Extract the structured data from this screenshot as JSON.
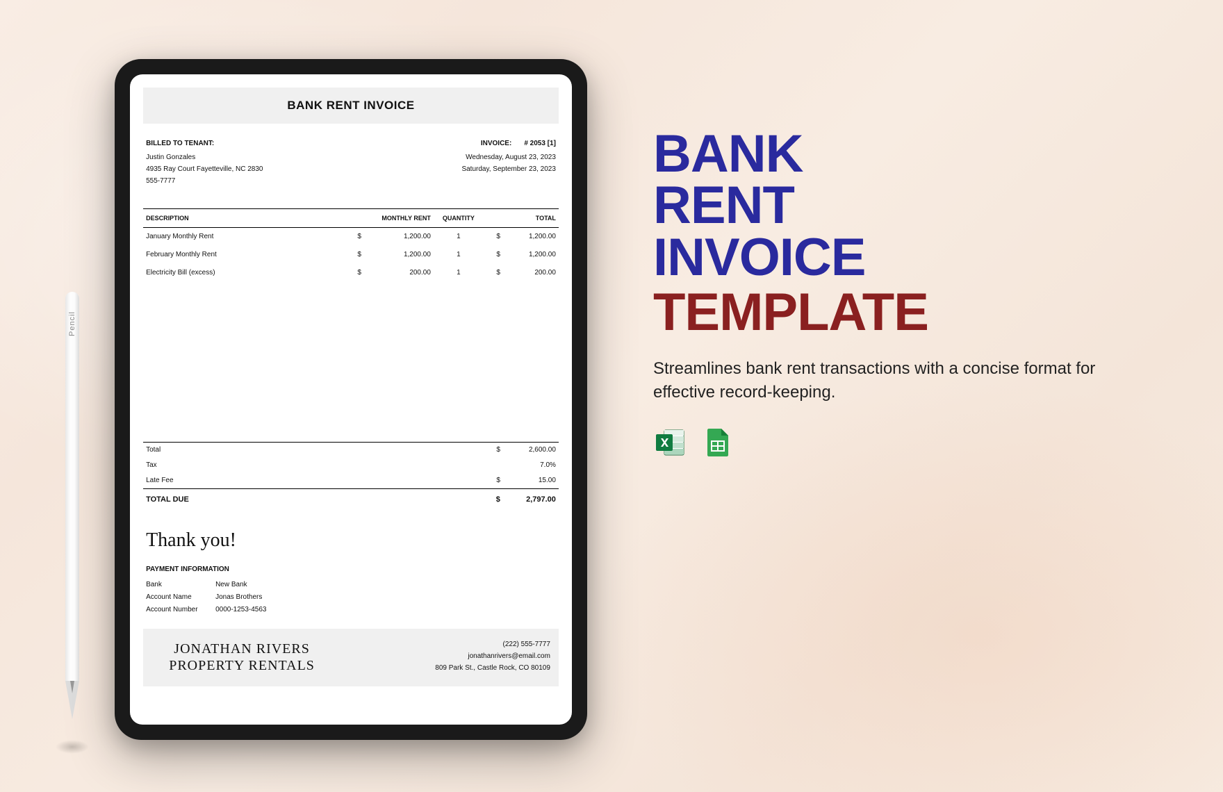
{
  "pencil": {
    "label": "Pencil"
  },
  "invoice": {
    "title": "BANK RENT INVOICE",
    "billed_to_label": "BILLED TO TENANT:",
    "tenant_name": "Justin Gonzales",
    "tenant_address": "4935 Ray Court Fayetteville, NC 2830",
    "tenant_phone": "555-7777",
    "invoice_label": "INVOICE:",
    "invoice_number": "# 2053 [1]",
    "date1": "Wednesday, August 23, 2023",
    "date2": "Saturday, September 23, 2023",
    "columns": {
      "description": "DESCRIPTION",
      "monthly_rent": "MONTHLY RENT",
      "quantity": "QUANTITY",
      "total": "TOTAL"
    },
    "items": [
      {
        "desc": "January Monthly Rent",
        "cur": "$",
        "rent": "1,200.00",
        "qty": "1",
        "tcur": "$",
        "total": "1,200.00"
      },
      {
        "desc": "February Monthly Rent",
        "cur": "$",
        "rent": "1,200.00",
        "qty": "1",
        "tcur": "$",
        "total": "1,200.00"
      },
      {
        "desc": "Electricity Bill (excess)",
        "cur": "$",
        "rent": "200.00",
        "qty": "1",
        "tcur": "$",
        "total": "200.00"
      }
    ],
    "totals": {
      "total_label": "Total",
      "total_cur": "$",
      "total_val": "2,600.00",
      "tax_label": "Tax",
      "tax_val": "7.0%",
      "late_label": "Late Fee",
      "late_cur": "$",
      "late_val": "15.00",
      "due_label": "TOTAL DUE",
      "due_cur": "$",
      "due_val": "2,797.00"
    },
    "thankyou": "Thank you!",
    "payment": {
      "label": "PAYMENT INFORMATION",
      "bank_label": "Bank",
      "bank": "New Bank",
      "account_name_label": "Account Name",
      "account_name": "Jonas Brothers",
      "account_number_label": "Account Number",
      "account_number": "0000-1253-4563"
    },
    "footer": {
      "company": "JONATHAN RIVERS PROPERTY RENTALS",
      "phone": "(222) 555-7777",
      "email": "jonathanrivers@email.com",
      "address": "809 Park St., Castle Rock, CO 80109"
    }
  },
  "promo": {
    "title_line1": "BANK",
    "title_line2": "RENT",
    "title_line3": "INVOICE",
    "title_line4": "TEMPLATE",
    "description": "Streamlines bank rent transactions with a concise format for effective record-keeping."
  },
  "icons": {
    "excel": "excel-icon",
    "sheets": "google-sheets-icon"
  }
}
